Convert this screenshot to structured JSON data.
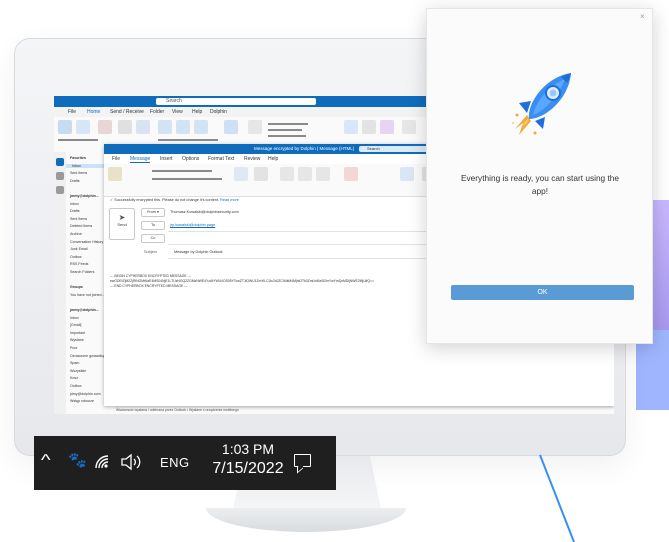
{
  "colors": {
    "accent": "#0f6cbd",
    "ok_button": "#5b9bd5",
    "taskbar": "#1f1f1f"
  },
  "outlook": {
    "menu": [
      "File",
      "Home",
      "Send / Receive",
      "Folder",
      "View",
      "Help",
      "Dolphin"
    ],
    "search_placeholder": "Search",
    "folders": [
      "Favorites",
      "Inbox",
      "Sent Items",
      "Drafts",
      "",
      "jmmy@dolphin...",
      "Inbox",
      "Drafts",
      "Sent Items",
      "Deleted Items",
      "Archive",
      "Conversation History",
      "Junk Email",
      "Outbox",
      "RSS Feeds",
      "Search Folders",
      "",
      "Groups",
      "You have not joined...",
      "",
      "jmmy@dolphin...",
      "Inbox",
      "[Gmail]",
      "Important",
      "Wysłane",
      "Poor",
      "Oznaczone gwiazdką",
      "Spam",
      "Wszystkie",
      "Kosz",
      "Outbox",
      "jdmy@dolphin.com",
      "Wstęp robocze"
    ]
  },
  "compose": {
    "title": "Message encrypted by Dolphin | Message (HTML)",
    "search_placeholder": "Search",
    "menu": [
      "File",
      "Message",
      "Insert",
      "Options",
      "Format Text",
      "Review",
      "Help"
    ],
    "info_bar_check": "✓",
    "info_bar_text": "Successfully encrypted this. Please do not change it's content.",
    "info_bar_link": "Read more",
    "send_label": "Send",
    "from_label": "From ▾",
    "from_value": "Thomasz.Kowalski@dolphinsecurity.com",
    "to_label": "To",
    "to_value": "jrp.kowalski@dolphin.page",
    "cc_label": "Cc",
    "cc_value": "",
    "subject_label": "Subject",
    "subject_value": "Message by Dolphin Outlook",
    "body_line1": "--- BEGIN CYPHERBOX ENCRYPTED MESSAGE ---",
    "body_line2": "ewODEtZjM2ZjRiNGMtNzE4MS04NjE1LTUzNGQ2ZGMzNWE4YzAtYWU4OS05YTcwZTJiOWU1ZmYiLCJtc2dJZCI6IkM4MjhiOTk0ZmUxMzI5ZmYwYmQxMDljNWE2MjUifQ==",
    "body_line3": "--- END CYPHERBOX ENCRYPTED MESSAGE ---",
    "bottom_strip": "Wiadomość wysłana / odebrana przez Outlook   •   Wysłane z urządzenia mobilnego"
  },
  "taskbar": {
    "chevron_icon": "^",
    "app_icon": "🐾",
    "wifi_icon": "◜",
    "volume_icon": "🔊",
    "language": "ENG",
    "time": "1:03 PM",
    "date": "7/15/2022",
    "notification_icon": "speech-bubble"
  },
  "dialog": {
    "close_label": "×",
    "message": "Everything is ready, you can start using the app!",
    "ok_label": "OK"
  }
}
